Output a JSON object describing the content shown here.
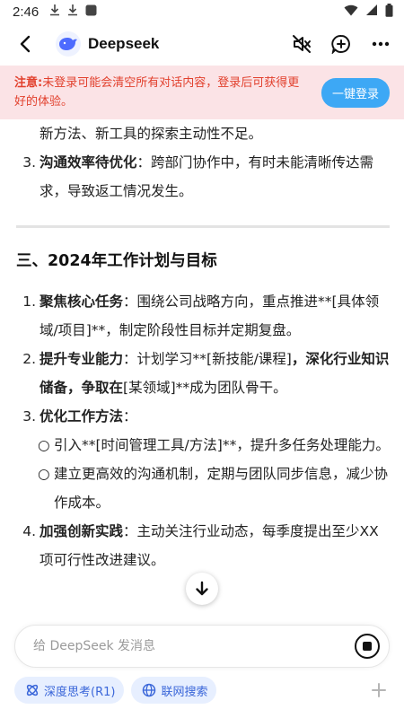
{
  "status_bar": {
    "time": "2:46"
  },
  "app_bar": {
    "title": "Deepseek"
  },
  "notice": {
    "label": "注意:",
    "text": "未登录可能会清空所有对话内容，登录后可获得更好的体验。",
    "login_button": "一键登录"
  },
  "content": {
    "top_continuation": "新方法、新工具的探索主动性不足。",
    "top_item": {
      "number": "3.",
      "bold": "沟通效率待优化",
      "text": "：跨部门协作中，有时未能清晰传达需求，导致返工情况发生。"
    },
    "section_title": "三、2024年工作计划与目标",
    "items": [
      {
        "number": "1.",
        "bold": "聚焦核心任务",
        "text": "：围绕公司战略方向，重点推进**[具体领域/项目]**，制定阶段性目标并定期复盘。"
      },
      {
        "number": "2.",
        "bold": "提升专业能力",
        "text": "：计划学习**[新技能/课程]",
        "bold2": "，深化行业知识储备，争取在",
        "text2": "[某领域]**成为团队骨干。"
      },
      {
        "number": "3.",
        "bold": "优化工作方法",
        "text": "：",
        "subitems": [
          {
            "bullet": "○",
            "text": "引入**[时间管理工具/方法]**，提升多任务处理能力。"
          },
          {
            "bullet": "○",
            "text": "建立更高效的沟通机制，定期与团队同步信息，减少协作成本。"
          }
        ]
      },
      {
        "number": "4.",
        "bold": "加强创新实践",
        "text": "：主动关注行业动态，每季度提出至少XX项可行性改进建议。"
      }
    ]
  },
  "composer": {
    "placeholder": "给 DeepSeek 发消息"
  },
  "chips": {
    "deep_think": "深度思考(R1)",
    "web_search": "联网搜索"
  },
  "colors": {
    "accent": "#3da8f5",
    "notice_bg": "#fbe3e6",
    "notice_text": "#e2402d",
    "chip_bg": "#e7efff",
    "chip_text": "#3a66d9"
  }
}
